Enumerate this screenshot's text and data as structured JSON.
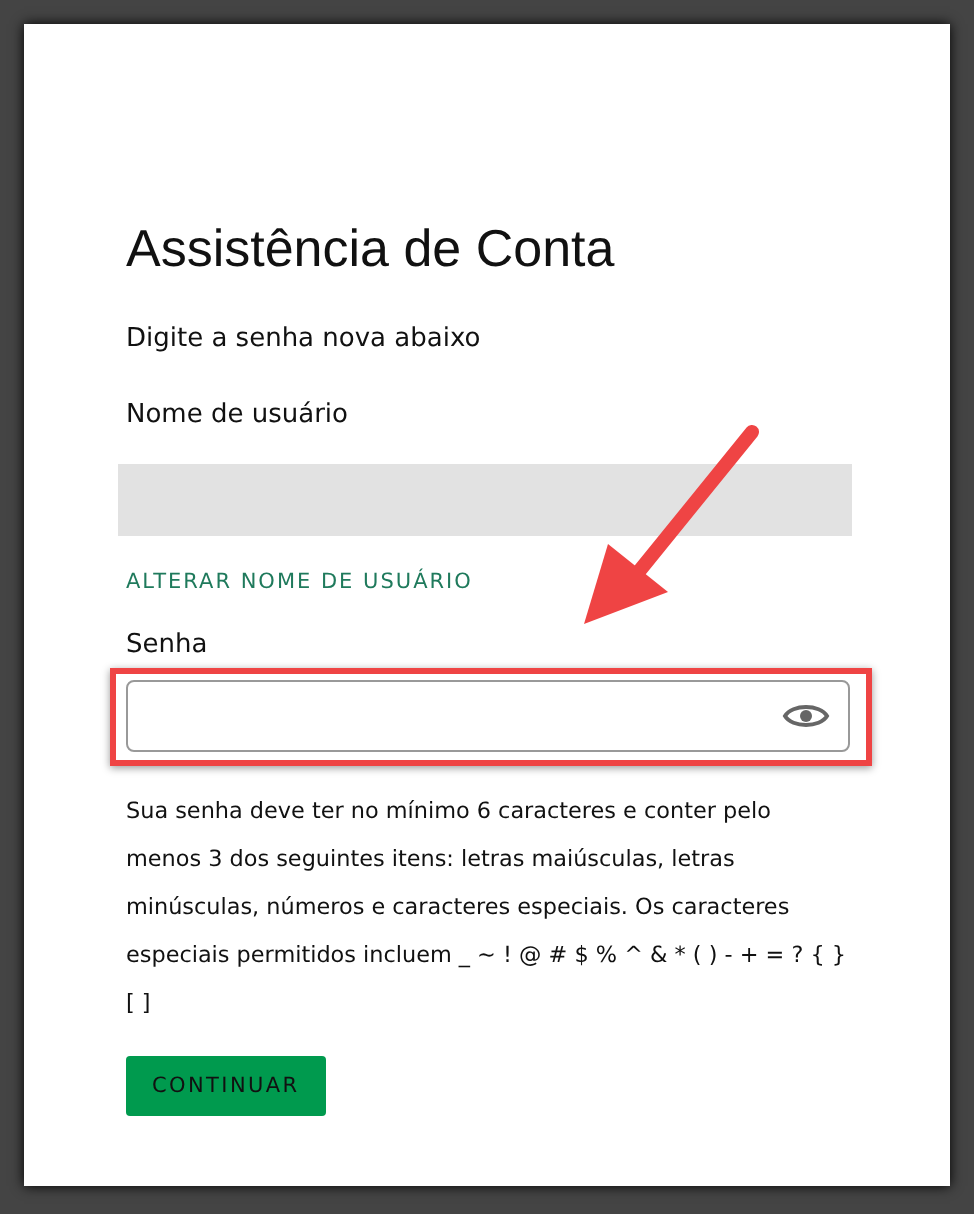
{
  "title": "Assistência de Conta",
  "subtitle": "Digite a senha nova abaixo",
  "username": {
    "label": "Nome de usuário",
    "redacted": true
  },
  "change_username_link": "ALTERAR NOME DE USUÁRIO",
  "password": {
    "label": "Senha",
    "highlighted": true
  },
  "password_rules": "Sua senha deve ter no mínimo 6 caracteres e conter pelo menos 3 dos seguintes itens: letras maiúsculas, letras minúsculas, números e caracteres especiais. Os caracteres especiais permitidos incluem _ ~ ! @ # $ % ^ & * ( ) - + = ? { } [ ]",
  "continue_button": "CONTINUAR"
}
